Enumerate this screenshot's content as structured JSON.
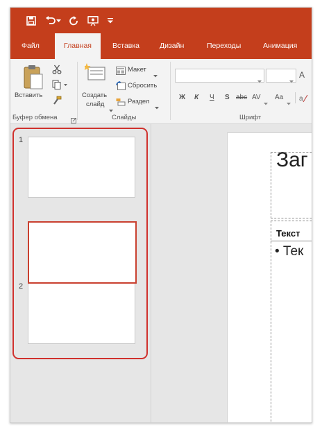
{
  "colors": {
    "accent": "#c43e1c",
    "highlight": "#d0312d",
    "ribbon_bg": "#f3f3f3",
    "workspace_bg": "#e6e6e6"
  },
  "quick_access": [
    "save-icon",
    "undo-icon",
    "redo-icon",
    "slideshow-icon",
    "customize-icon"
  ],
  "tabs": [
    {
      "label": "Файл"
    },
    {
      "label": "Главная",
      "active": true
    },
    {
      "label": "Вставка"
    },
    {
      "label": "Дизайн"
    },
    {
      "label": "Переходы"
    },
    {
      "label": "Анимация"
    }
  ],
  "ribbon": {
    "clipboard": {
      "paste_label": "Вставить",
      "group_label": "Буфер обмена",
      "icons": [
        "paste-icon",
        "cut-icon",
        "copy-icon",
        "format-painter-icon"
      ]
    },
    "slides": {
      "new_slide_label_line1": "Создать",
      "new_slide_label_line2": "слайд",
      "layout_label": "Макет",
      "reset_label": "Сбросить",
      "section_label": "Раздел",
      "group_label": "Слайды"
    },
    "font": {
      "group_label": "Шрифт",
      "bold": "Ж",
      "italic": "К",
      "underline": "Ч",
      "shadow": "S",
      "strike": "abc",
      "spacing": "AV",
      "case": "Aa",
      "grow": "A"
    }
  },
  "thumbnails": [
    {
      "number": "1"
    },
    {
      "number": "2"
    }
  ],
  "slide": {
    "title": "Заг",
    "subtitle": "Текст",
    "bullet": "• Тек"
  }
}
